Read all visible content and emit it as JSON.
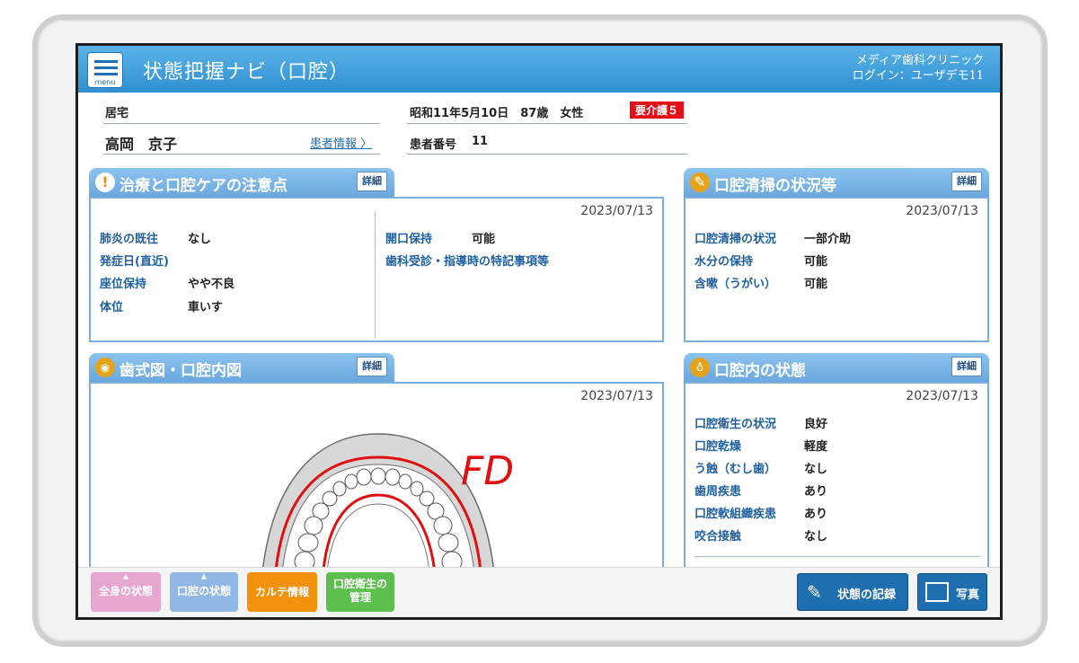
{
  "header": {
    "menu_label": "menu",
    "title": "状態把握ナビ（口腔）",
    "clinic_name": "メディア歯科クリニック",
    "login": "ログイン：ユーザデモ11"
  },
  "patient": {
    "residence": "居宅",
    "name": "高岡　京子",
    "info_link": "患者情報 〉",
    "birth_age_sex": "昭和11年5月10日　87歳　女性",
    "care_level": "要介護５",
    "id_label": "患者番号",
    "id_value": "11"
  },
  "panels": {
    "caution": {
      "title": "治療と口腔ケアの注意点",
      "detail": "詳細",
      "date": "2023/07/13",
      "left_items": [
        {
          "key": "肺炎の既往",
          "value": "なし"
        },
        {
          "key": "発症日(直近)",
          "value": ""
        },
        {
          "key": "座位保持",
          "value": "やや不良"
        },
        {
          "key": "体位",
          "value": "車いす"
        }
      ],
      "right_items": [
        {
          "key": "開口保持",
          "value": "可能"
        },
        {
          "key": "歯科受診・指導時の特記事項等",
          "value": ""
        }
      ]
    },
    "cleaning": {
      "title": "口腔清掃の状況等",
      "detail": "詳細",
      "date": "2023/07/13",
      "items": [
        {
          "key": "口腔清掃の状況",
          "value": "一部介助"
        },
        {
          "key": "水分の保持",
          "value": "可能"
        },
        {
          "key": "含嗽（うがい）",
          "value": "可能"
        }
      ]
    },
    "dental_chart": {
      "title": "歯式図・口腔内図",
      "detail": "詳細",
      "date": "2023/07/13",
      "annotation": "FD"
    },
    "oral_state": {
      "title": "口腔内の状態",
      "detail": "詳細",
      "date": "2023/07/13",
      "items": [
        {
          "key": "口腔衛生の状況",
          "value": "良好"
        },
        {
          "key": "口腔乾燥",
          "value": "軽度"
        },
        {
          "key": "う蝕（むし歯）",
          "value": "なし"
        },
        {
          "key": "歯周疾患",
          "value": "あり"
        },
        {
          "key": "口腔軟組織疾患",
          "value": "あり"
        },
        {
          "key": "咬合接触",
          "value": "なし"
        }
      ]
    }
  },
  "bottom_nav": {
    "tabs": [
      {
        "label": "全身の状態",
        "color": "#e7a6cf"
      },
      {
        "label": "口腔の状態",
        "color": "#8fb8e6"
      },
      {
        "label": "カルテ情報",
        "color": "#f0920e"
      },
      {
        "label_line1": "口腔衛生の",
        "label_line2": "管理",
        "color": "#5cbf4e"
      }
    ],
    "record_button": "状態の記録",
    "photo_button": "写真"
  }
}
